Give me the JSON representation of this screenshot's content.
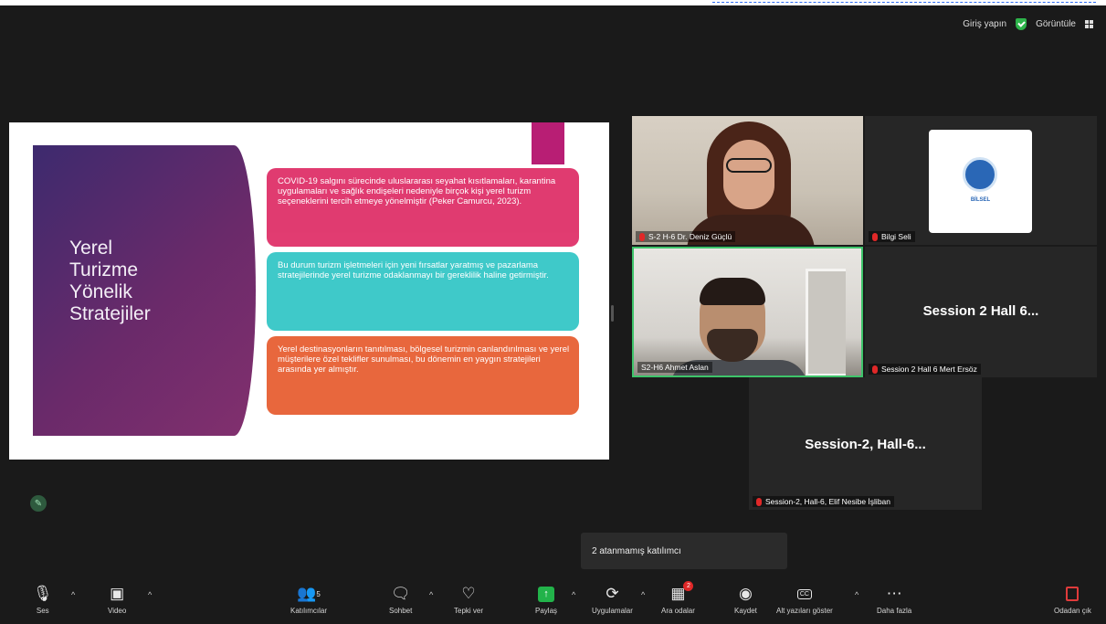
{
  "top_bar": {
    "sign_in_label": "Giriş yapın",
    "view_label": "Görüntüle"
  },
  "slide": {
    "title_lines": [
      "Yerel",
      "Turizme",
      "Yönelik",
      "Stratejiler"
    ],
    "box1": "COVID-19 salgını sürecinde uluslararası seyahat kısıtlamaları, karantina uygulamaları ve sağlık endişeleri nedeniyle birçok kişi yerel turizm seçeneklerini tercih etmeye yönelmiştir (Peker Camurcu, 2023).",
    "box2": "Bu durum turizm işletmeleri için yeni fırsatlar yaratmış ve pazarlama stratejilerinde yerel turizme odaklanmayı bir gereklilik haline getirmiştir.",
    "box3": "Yerel destinasyonların tanıtılması, bölgesel turizmin canlandırılması ve yerel müşterilere özel teklifler sunulması, bu dönemin en yaygın stratejileri arasında yer almıştır.",
    "colors": {
      "panel": "#5a2a6c",
      "box1": "#e0386e",
      "box2": "#3cc8c8",
      "box3": "#e8643a",
      "accent": "#b81e74"
    }
  },
  "participants": [
    {
      "label": "S-2 H-6 Dr. Deniz Güçlü",
      "muted": true
    },
    {
      "label": "S2-H6 Ahmet Aslan",
      "muted": false,
      "active_speaker": true
    },
    {
      "label": "Bilgi Seli",
      "muted": true,
      "logo_text": "BİLSEL"
    },
    {
      "label": "Session 2 Hall 6 Mert Ersöz",
      "muted": true,
      "display_name": "Session 2 Hall 6..."
    },
    {
      "label": "Session-2, Hall-6, Elif Nesibe İşliban",
      "muted": true,
      "display_name": "Session-2,  Hall-6..."
    }
  ],
  "tooltip": "2 atanmamış katılımcı",
  "toolbar": {
    "audio": "Ses",
    "video": "Video",
    "participants": "Katılımcılar",
    "participants_count": "5",
    "chat": "Sohbet",
    "reactions": "Tepki ver",
    "share": "Paylaş",
    "apps": "Uygulamalar",
    "breakout": "Ara odalar",
    "breakout_badge": "2",
    "record": "Kaydet",
    "captions": "Alt yazıları göster",
    "more": "Daha fazla",
    "leave": "Odadan çık"
  }
}
